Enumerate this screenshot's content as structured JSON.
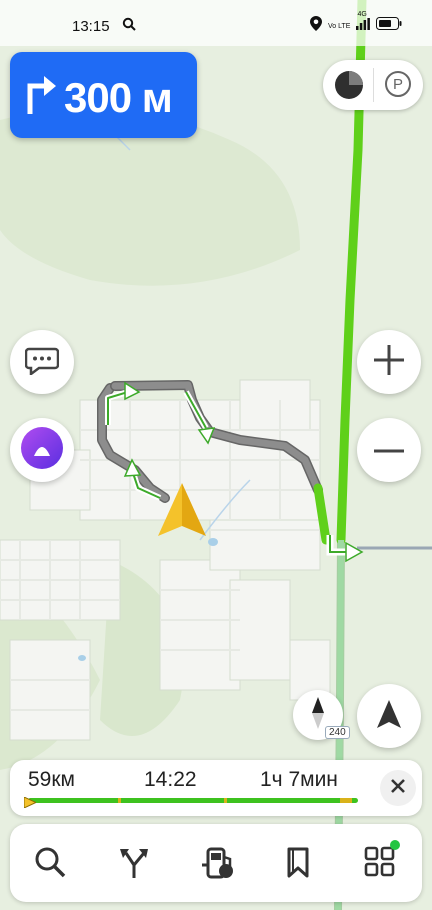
{
  "status_bar": {
    "time": "13:15",
    "volte_label": "Vo LTE",
    "network_label": "4G",
    "icons": [
      "search-icon",
      "location-pin-icon",
      "signal-icon",
      "battery-icon"
    ]
  },
  "maneuver": {
    "icon": "turn-right-arrow-icon",
    "distance": "300 м"
  },
  "top_controls": {
    "icons": [
      "traffic-lights-icon",
      "parking-icon"
    ],
    "parking_label": "P"
  },
  "side_controls": {
    "left": [
      "chat-icon",
      "alice-voice-assistant-icon"
    ],
    "right": [
      "zoom-in-icon",
      "zoom-out-icon"
    ]
  },
  "map": {
    "road_number": "240",
    "compass_icon": "compass-icon",
    "locate_icon": "navigation-arrow-icon"
  },
  "trip": {
    "distance": "59км",
    "arrival_time": "14:22",
    "duration": "1ч 7мин",
    "progress": 0.02
  },
  "bottom_nav": {
    "items": [
      "search-icon",
      "route-icon",
      "gas-station-icon",
      "bookmarks-icon",
      "services-grid-icon"
    ],
    "accent_color": "#22c541"
  },
  "colors": {
    "maneuver_bg": "#1f6bf5",
    "route_green": "#5fd01a",
    "route_grey": "#8d8d8d",
    "alice_purple": "#8a3ff0"
  }
}
